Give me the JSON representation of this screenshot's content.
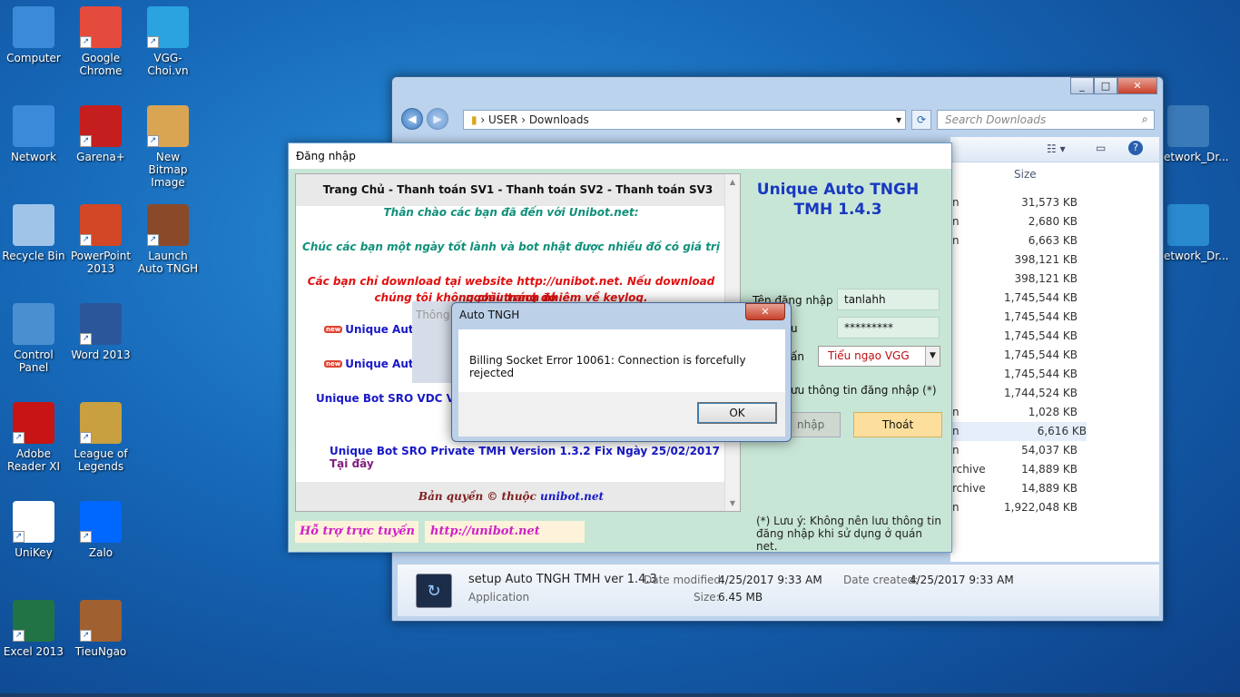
{
  "desktop": {
    "icons": [
      {
        "label": "Computer",
        "color": "#3b8ad9"
      },
      {
        "label": "Google Chrome",
        "color": "#e54b3c"
      },
      {
        "label": "VGG-Choi.vn",
        "color": "#2aa3e0"
      },
      {
        "label": "Network",
        "color": "#3b8ad9"
      },
      {
        "label": "Garena+",
        "color": "#c41e1e"
      },
      {
        "label": "New Bitmap Image",
        "color": "#d9a552"
      },
      {
        "label": "Recycle Bin",
        "color": "#9fc4e8"
      },
      {
        "label": "PowerPoint 2013",
        "color": "#d24726"
      },
      {
        "label": "Launch Auto TNGH",
        "color": "#8a4a2a"
      },
      {
        "label": "Control Panel",
        "color": "#4a90d0"
      },
      {
        "label": "Word 2013",
        "color": "#2b579a"
      },
      {
        "label": "Adobe Reader XI",
        "color": "#c81414"
      },
      {
        "label": "League of Legends",
        "color": "#c8a040"
      },
      {
        "label": "UniKey",
        "color": "#ffffff"
      },
      {
        "label": "Zalo",
        "color": "#0068ff"
      },
      {
        "label": "Excel 2013",
        "color": "#217346"
      },
      {
        "label": "TieuNgao",
        "color": "#a06030"
      },
      {
        "label": "Network_Dr...",
        "color": "#3a7ab8"
      },
      {
        "label": "Network_Dr...",
        "color": "#2a8ad0"
      }
    ]
  },
  "explorer": {
    "path": [
      "USER",
      "Downloads"
    ],
    "search_placeholder": "Search Downloads",
    "column_size": "Size",
    "files": [
      {
        "type": "n",
        "size": "31,573 KB"
      },
      {
        "type": "n",
        "size": "2,680 KB"
      },
      {
        "type": "n",
        "size": "6,663 KB"
      },
      {
        "type": "",
        "size": "398,121 KB"
      },
      {
        "type": "",
        "size": "398,121 KB"
      },
      {
        "type": "",
        "size": "1,745,544 KB"
      },
      {
        "type": "",
        "size": "1,745,544 KB"
      },
      {
        "type": "",
        "size": "1,745,544 KB"
      },
      {
        "type": "",
        "size": "1,745,544 KB"
      },
      {
        "type": "",
        "size": "1,745,544 KB"
      },
      {
        "type": "",
        "size": "1,744,524 KB"
      },
      {
        "type": "n",
        "size": "1,028 KB"
      },
      {
        "type": "n",
        "size": "6,616 KB"
      },
      {
        "type": "n",
        "size": "54,037 KB"
      },
      {
        "type": "rchive",
        "size": "14,889 KB"
      },
      {
        "type": "rchive",
        "size": "14,889 KB"
      },
      {
        "type": "n",
        "size": "1,922,048 KB"
      }
    ],
    "details": {
      "name": "setup Auto TNGH TMH ver 1.4.3",
      "kind": "Application",
      "modified_label": "Date modified:",
      "modified": "4/25/2017 9:33 AM",
      "created_label": "Date created:",
      "created": "4/25/2017 9:33 AM",
      "size_label": "Size:",
      "size": "6.45 MB"
    }
  },
  "login": {
    "title": "Đăng nhập",
    "browser": {
      "menu": "Trang Chủ - Thanh toán SV1 - Thanh toán SV2 - Thanh toán SV3",
      "greeting": "Thân chào các bạn đã đến với Unibot.net:",
      "wish": "Chúc các bạn một ngày tốt lành và bot nhật được nhiều đồ có giá trị",
      "warning_1": "Các bạn chỉ download tại website http://unibot.net. Nếu download ngoài trang đó",
      "warning_2": "chúng tôi không chịu trách nhiệm về keylog.",
      "new_tag": "new",
      "link_1": "Unique Auto",
      "link_2": "Unique Auto",
      "overlay_text": "Thông",
      "link_3": "Unique Bot SRO VDC Versi",
      "link_4": "Unique Bot SRO Private TMH Version 1.3.2 Fix Ngày 25/02/2017 :",
      "link_4_tail": "Tại đây",
      "copyright": "Bản quyền © thuộc",
      "copyright_site": "unibot.net"
    },
    "support_label": "Hỗ trợ trực tuyến",
    "support_url": "http://unibot.net",
    "app_title_1": "Unique Auto TNGH",
    "app_title_2": "TMH 1.4.3",
    "username_label": "Tên đăng nhập",
    "username": "tanlahh",
    "password_label_tail": "u",
    "password": "*********",
    "server_label_tail": "ấn",
    "server": "Tiểu ngạo VGG",
    "remember": "ưu thông tin đăng nhập (*)",
    "login_button": "nhập",
    "exit_button": "Thoát",
    "note": "(*) Lưu ý:  Không nên lưu thông tin đăng nhập khi sử dụng ở quán net."
  },
  "dialog": {
    "title": "Auto TNGH",
    "message": "Billing Socket Error 10061: Connection is forcefully rejected",
    "ok": "OK"
  }
}
